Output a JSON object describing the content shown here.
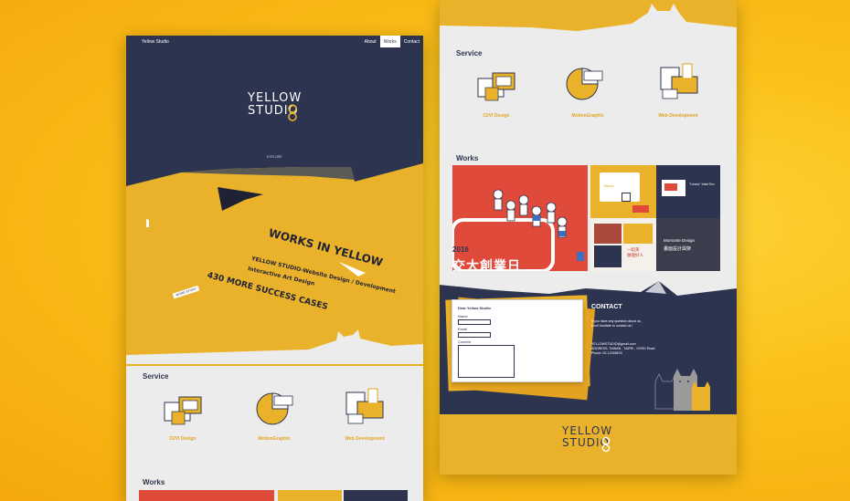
{
  "site": {
    "brand": "Yellow Studio",
    "logo_line1": "YELLOW",
    "logo_line2": "STUDIO"
  },
  "nav": {
    "items": [
      {
        "label": "About"
      },
      {
        "label": "Works"
      },
      {
        "label": "Contact"
      }
    ],
    "active": "Works"
  },
  "hero": {
    "explore": "EXPLORE",
    "headline": "WORKS IN YELLOW",
    "line1": "YELLOW STUDIO-Website Design / Development",
    "line2": "Interactive Art Design",
    "line3": "430 MORE SUCCESS CASES",
    "tag": "MORE STORY"
  },
  "service": {
    "title": "Service",
    "items": [
      {
        "label": "CI/VI Design",
        "icon": "design-board-icon"
      },
      {
        "label": "MotionGraphic",
        "icon": "pie-chart-icon"
      },
      {
        "label": "Web Development",
        "icon": "devices-icon"
      }
    ]
  },
  "works": {
    "title": "Works",
    "tiles": [
      {
        "caption": "2016",
        "subcaption": "交大創業日"
      },
      {
        "caption": "Yellow"
      },
      {
        "caption": "\"Lines\" InterTec"
      },
      {
        "caption": ""
      },
      {
        "caption": "一起來\n做個好人"
      },
      {
        "caption": "Momonte Design",
        "subcaption": "畫面設計與架"
      }
    ]
  },
  "contact": {
    "title": "CONTACT",
    "form_title": "Dear Yellow Studio",
    "name_label": "Name",
    "email_label": "Email",
    "content_label": "Content",
    "intro_line1": "If you have any question about us,",
    "intro_line2": "Don't hesitate to contact us !",
    "email": "YELLOWSTUDIO@gmail.com",
    "address": "ADDRESS: TAINAN , TAIPEI , XORG Road",
    "phone": "Phone: 02-12345678"
  },
  "colors": {
    "navy": "#2d3450",
    "yellow": "#eab22a",
    "light": "#ececec",
    "red": "#e04a3b"
  }
}
